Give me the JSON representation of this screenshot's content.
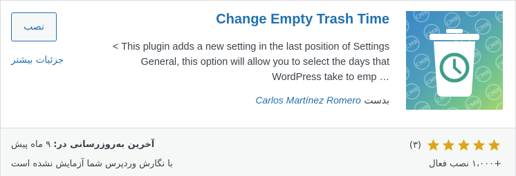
{
  "plugin": {
    "title": "Change Empty Trash Time",
    "description_lines": [
      "This plugin adds a new setting in the last position of Settings >",
      "General, this option will allow you to select the days that",
      "… WordPress take to emp"
    ],
    "author_prefix": "بدست",
    "author_name": "Carlos Martínez Romero",
    "icon_name": "trash-clock-icon",
    "watermark_text": "CMR"
  },
  "actions": {
    "install_label": "نصب",
    "details_label": "جزئیات بیشتر"
  },
  "stats": {
    "rating_stars": 5,
    "rating_count": "(۳)",
    "installs": "+۱،۰۰۰ نصب فعال",
    "last_updated_label": "آخرین به‌روزرسانی در:",
    "last_updated_value": "۹ ماه پیش",
    "compatibility": "با نگارش وردپرس شما آزمایش نشده است"
  },
  "colors": {
    "link_blue": "#2271b1",
    "star_gold": "#dba617",
    "text": "#3c434a",
    "footer_bg": "#f6f7f7"
  }
}
